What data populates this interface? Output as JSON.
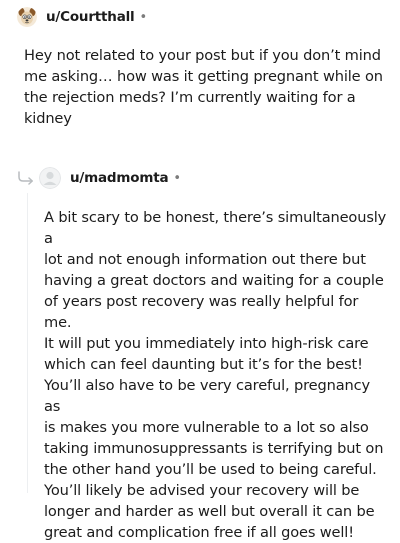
{
  "comments": [
    {
      "username": "u/Courtthall",
      "separator": "•",
      "avatar_icon": "dog-avatar-icon",
      "body": "Hey not related to your post but if you don’t mind\nme asking… how was it getting pregnant while on\nthe rejection meds? I’m currently waiting for a\nkidney"
    },
    {
      "username": "u/madmomta",
      "separator": "•",
      "avatar_icon": "default-avatar-icon",
      "reply_icon": "reply-arrow-icon",
      "body": "A bit scary to be honest, there’s simultaneously a\nlot and not enough information out there but\nhaving a great doctors and waiting for a couple\nof years post recovery was really helpful for me.\nIt will put you immediately into high-risk care\nwhich can feel daunting but it’s for the best!\nYou’ll also have to be very careful, pregnancy as\nis makes you more vulnerable to a lot so also\ntaking immunosuppressants is terrifying but on\nthe other hand you’ll be used to being careful.\nYou’ll likely be advised your recovery will be\nlonger and harder as well but overall it can be\ngreat and complication free if all goes well!"
    }
  ]
}
